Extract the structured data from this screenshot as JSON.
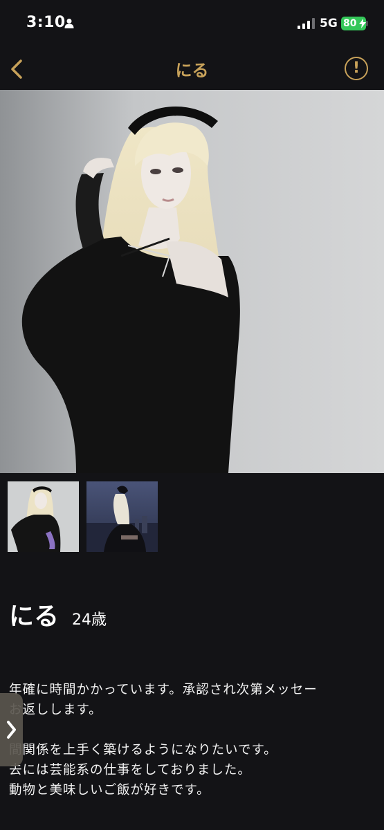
{
  "status_bar": {
    "time": "3:10",
    "network": "5G",
    "battery": "80"
  },
  "nav": {
    "title": "にる",
    "back_icon": "chevron-left-icon",
    "report_icon": "exclamation-circle-icon",
    "report_symbol": "!"
  },
  "photos": {
    "count": 2
  },
  "profile": {
    "name": "にる",
    "age": "24歳",
    "bio": "年確に時間かかっています。承認され次第メッセー\nお返しします。\n\n間関係を上手く築けるようになりたいです。\n去には芸能系の仕事をしておりました。\n動物と美味しいご飯が好きです。"
  },
  "edge_tab": {
    "icon": "chevron-right-icon"
  },
  "colors": {
    "background": "#131316",
    "accent": "#c8a25a",
    "battery": "#34c759"
  }
}
